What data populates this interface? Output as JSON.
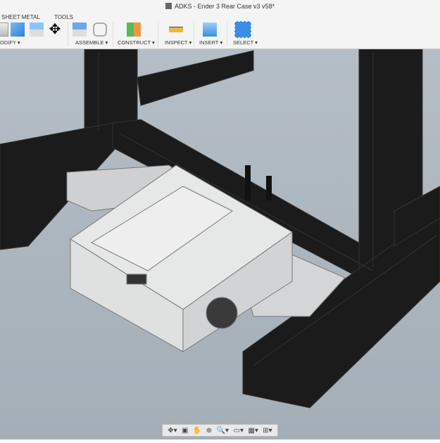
{
  "title": "ADKS - Ender 3 Rear Case v3 v58*",
  "tabs": [
    "SHEET METAL",
    "TOOLS"
  ],
  "groups": {
    "modify": "ODIFY ▾",
    "assemble": "ASSEMBLE ▾",
    "construct": "CONSTRUCT ▾",
    "inspect": "INSPECT ▾",
    "insert": "INSERT ▾",
    "select": "SELECT ▾"
  },
  "nav": {
    "orbit": "✥▾",
    "look": "▣",
    "pan": "✋",
    "zoom_window": "⊕",
    "zoom": "🔍▾",
    "display": "▭▾",
    "grid": "▦▾",
    "viewports": "⊞▾"
  },
  "colors": {
    "accent": "#3a8ee6",
    "frame": "#1a1a1a",
    "case": "#e4e5e5"
  }
}
